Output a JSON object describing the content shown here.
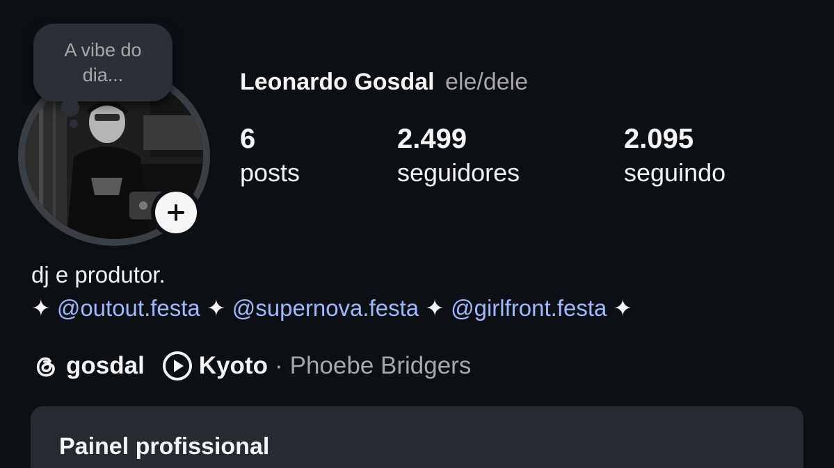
{
  "note": {
    "text": "A vibe do dia..."
  },
  "profile": {
    "name": "Leonardo Gosdal",
    "pronouns": "ele/dele",
    "avatar_icon": "profile-photo"
  },
  "stats": {
    "posts": {
      "value": "6",
      "label": "posts"
    },
    "followers": {
      "value": "2.499",
      "label": "seguidores"
    },
    "following": {
      "value": "2.095",
      "label": "seguindo"
    }
  },
  "bio": {
    "line1": "dj e produtor.",
    "sparkle": "✦",
    "mentions": [
      "@outout.festa",
      "@supernova.festa",
      "@girlfront.festa"
    ]
  },
  "links": {
    "threads_icon": "threads-icon",
    "threads_handle": "gosdal",
    "music_icon": "play-circle-icon",
    "music_title": "Kyoto",
    "music_separator": "·",
    "music_artist": "Phoebe Bridgers"
  },
  "professional_dashboard": {
    "title": "Painel profissional"
  },
  "colors": {
    "background": "#0c1014",
    "text_primary": "#f5f5f5",
    "text_secondary": "#a8a8a8",
    "mention": "#a0b8ff",
    "card_bg": "#262a31"
  }
}
